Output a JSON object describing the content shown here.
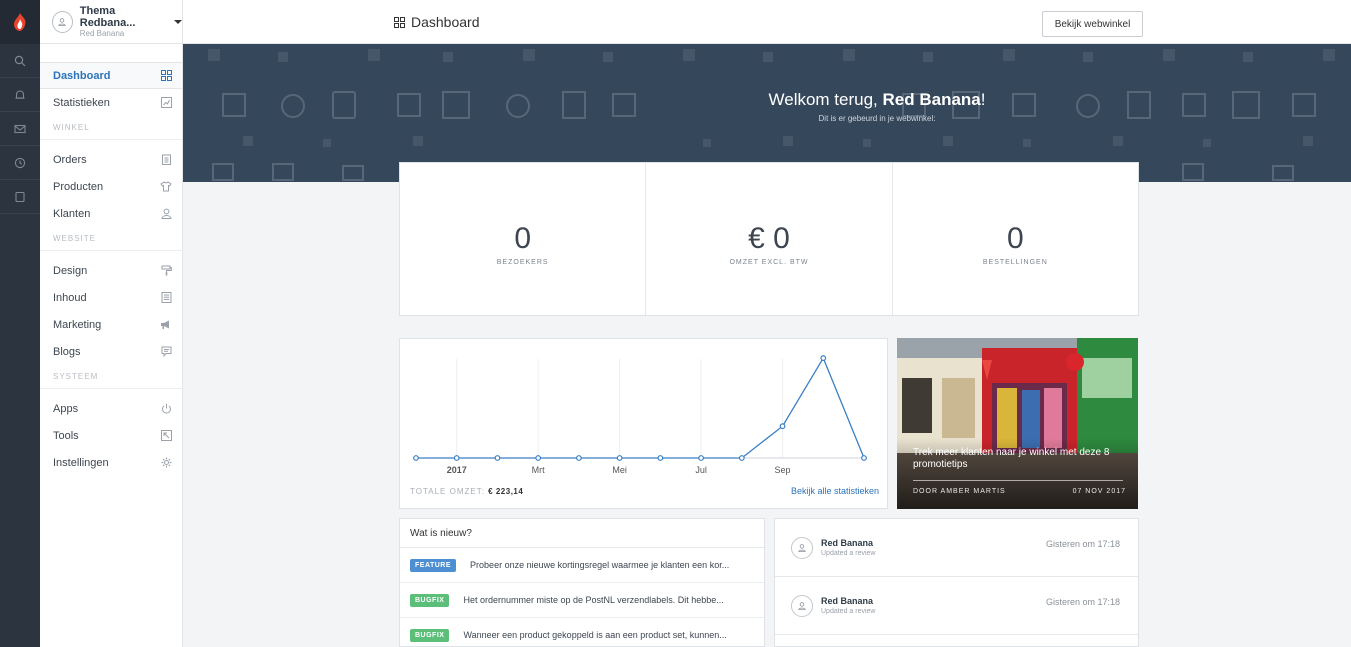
{
  "shop": {
    "name": "Thema Redbana...",
    "owner": "Red Banana"
  },
  "sidebar": {
    "items": [
      {
        "label": "Dashboard",
        "icon": "dashboard-grid-icon",
        "active": true
      },
      {
        "label": "Statistieken",
        "icon": "chart-icon"
      }
    ],
    "winkel_label": "WINKEL",
    "winkel": [
      {
        "label": "Orders",
        "icon": "clipboard-icon"
      },
      {
        "label": "Producten",
        "icon": "tshirt-icon"
      },
      {
        "label": "Klanten",
        "icon": "user-icon"
      }
    ],
    "website_label": "WEBSITE",
    "website": [
      {
        "label": "Design",
        "icon": "paint-roller-icon"
      },
      {
        "label": "Inhoud",
        "icon": "document-icon"
      },
      {
        "label": "Marketing",
        "icon": "megaphone-icon"
      },
      {
        "label": "Blogs",
        "icon": "chat-icon"
      }
    ],
    "systeem_label": "SYSTEEM",
    "systeem": [
      {
        "label": "Apps",
        "icon": "power-icon"
      },
      {
        "label": "Tools",
        "icon": "image-icon"
      },
      {
        "label": "Instellingen",
        "icon": "gear-icon"
      }
    ]
  },
  "topbar": {
    "title": "Dashboard",
    "shop_button": "Bekijk webwinkel"
  },
  "hero": {
    "greeting": "Welkom terug, ",
    "name": "Red Banana",
    "exclaim": "!",
    "subtitle": "Dit is er gebeurd in je webwinkel:"
  },
  "stats": [
    {
      "value": "0",
      "label": "BEZOEKERS"
    },
    {
      "value": "€ 0",
      "label": "OMZET EXCL. BTW"
    },
    {
      "value": "0",
      "label": "BESTELLINGEN"
    }
  ],
  "chart_footer": {
    "total_label": "TOTALE OMZET:",
    "total_value": "€ 223,14",
    "link": "Bekijk alle statistieken"
  },
  "chart_data": {
    "type": "line",
    "x": [
      "2017-01",
      "2017-02",
      "2017-03",
      "2017-04",
      "2017-05",
      "2017-06",
      "2017-07",
      "2017-08",
      "2017-09",
      "2017-10",
      "2017-11",
      "2017-12"
    ],
    "tick_labels": [
      "2017",
      "Mrt",
      "Mei",
      "Jul",
      "Sep"
    ],
    "series": [
      {
        "values": [
          0,
          0,
          0,
          0,
          0,
          0,
          0,
          0,
          0,
          35,
          110,
          0
        ]
      }
    ],
    "ylim": [
      0,
      120
    ],
    "grid": true,
    "colors": {
      "line": "#3a7fc4"
    }
  },
  "promo": {
    "title": "Trek meer klanten naar je winkel met deze 8 promotietips",
    "author": "DOOR AMBER MARTIS",
    "date": "07 NOV 2017"
  },
  "news": {
    "title": "Wat is nieuw?",
    "items": [
      {
        "badge": "FEATURE",
        "kind": "feature",
        "text": "Probeer onze nieuwe kortingsregel waarmee je klanten een kor..."
      },
      {
        "badge": "BUGFIX",
        "kind": "bugfix",
        "text": "Het ordernummer miste op de PostNL verzendlabels. Dit hebbe..."
      },
      {
        "badge": "BUGFIX",
        "kind": "bugfix",
        "text": "Wanneer een product gekoppeld is aan een product set, kunnen..."
      }
    ]
  },
  "activity": [
    {
      "name": "Red Banana",
      "desc": "Updated a review",
      "time": "Gisteren om 17:18"
    },
    {
      "name": "Red Banana",
      "desc": "Updated a review",
      "time": "Gisteren om 17:18"
    }
  ]
}
